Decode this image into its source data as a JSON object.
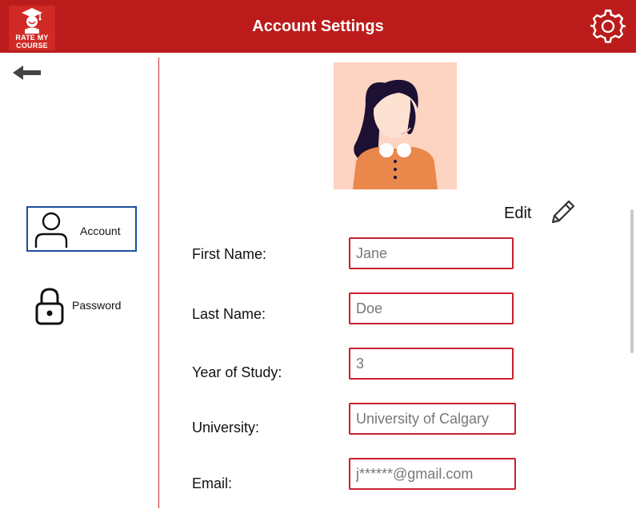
{
  "header": {
    "logo_line1": "RATE MY",
    "logo_line2": "COURSE",
    "title": "Account Settings",
    "settings_icon": "gear-icon",
    "brand_color": "#bb1b1b"
  },
  "nav": {
    "back_icon": "arrow-left-icon",
    "items": [
      {
        "label": "Account",
        "icon": "user-icon",
        "active": true
      },
      {
        "label": "Password",
        "icon": "lock-icon",
        "active": false
      }
    ],
    "active_border_color": "#1a4f9e"
  },
  "profile": {
    "avatar_icon": "profile-picture-avatar",
    "edit_label": "Edit",
    "edit_icon": "pencil-icon"
  },
  "form": {
    "first_name": {
      "label": "First Name:",
      "value": "Jane"
    },
    "last_name": {
      "label": "Last Name:",
      "value": "Doe"
    },
    "year_of_study": {
      "label": "Year of Study:",
      "value": "3"
    },
    "university": {
      "label": "University:",
      "value": "University of Calgary"
    },
    "email": {
      "label": "Email:",
      "value": "j******@gmail.com"
    },
    "field_border_color": "#c8202b"
  }
}
